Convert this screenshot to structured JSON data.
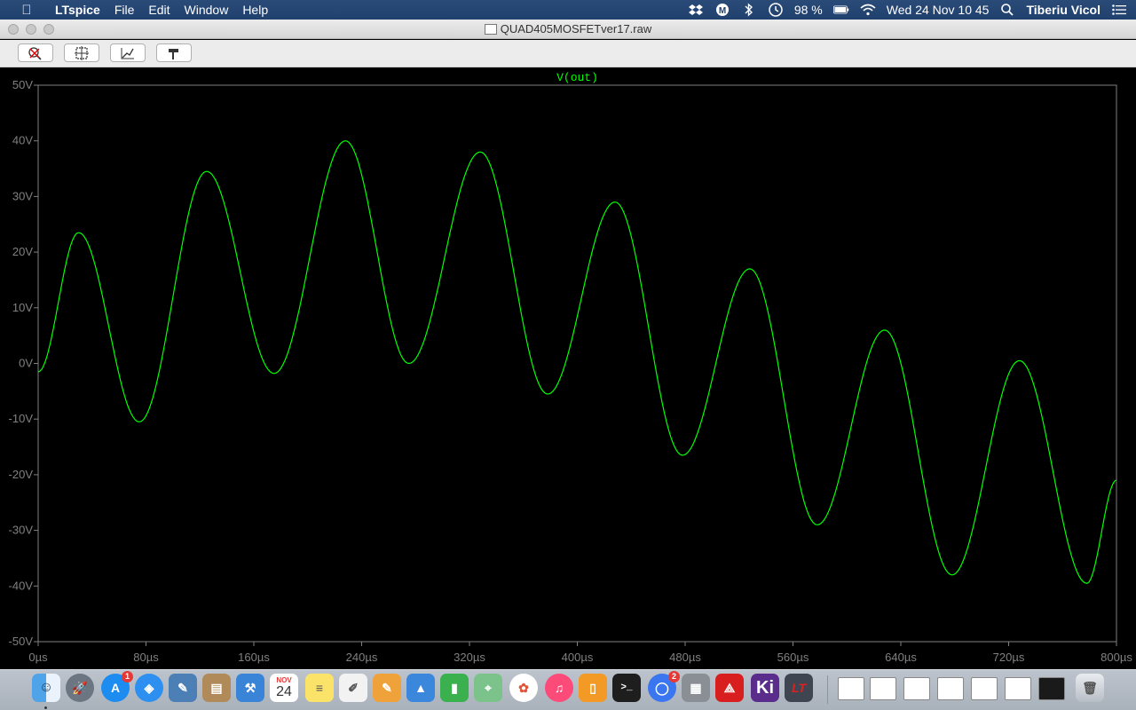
{
  "menubar": {
    "app_name": "LTspice",
    "items": [
      "File",
      "Edit",
      "Window",
      "Help"
    ],
    "battery": "98 %",
    "datetime": "Wed 24 Nov  10 45",
    "user": "Tiberiu Vicol"
  },
  "window": {
    "title": "QUAD405MOSFETver17.raw"
  },
  "toolbar": {
    "buttons": [
      "zoom-off-icon",
      "zoom-extents-icon",
      "zoom-back-icon",
      "hammer-icon"
    ]
  },
  "chart_data": {
    "type": "line",
    "series": [
      {
        "name": "V(out)",
        "color": "#00ff00",
        "x_unit": "µs",
        "y_unit": "V",
        "x": [
          0,
          30,
          75,
          125,
          175,
          228,
          275,
          328,
          378,
          428,
          478,
          528,
          578,
          628,
          678,
          728,
          778,
          800
        ],
        "y": [
          -1.5,
          23.5,
          -10.5,
          34.5,
          -1.8,
          40,
          0,
          38,
          -5.5,
          29,
          -16.5,
          17,
          -29,
          6,
          -38,
          0.5,
          -39.5,
          -21
        ]
      }
    ],
    "xlim": [
      0,
      800
    ],
    "ylim": [
      -50,
      50
    ],
    "xticks": [
      {
        "value": 0,
        "label": "0µs"
      },
      {
        "value": 80,
        "label": "80µs"
      },
      {
        "value": 160,
        "label": "160µs"
      },
      {
        "value": 240,
        "label": "240µs"
      },
      {
        "value": 320,
        "label": "320µs"
      },
      {
        "value": 400,
        "label": "400µs"
      },
      {
        "value": 480,
        "label": "480µs"
      },
      {
        "value": 560,
        "label": "560µs"
      },
      {
        "value": 640,
        "label": "640µs"
      },
      {
        "value": 720,
        "label": "720µs"
      },
      {
        "value": 800,
        "label": "800µs"
      }
    ],
    "yticks": [
      {
        "value": 50,
        "label": "50V"
      },
      {
        "value": 40,
        "label": "40V"
      },
      {
        "value": 30,
        "label": "30V"
      },
      {
        "value": 20,
        "label": "20V"
      },
      {
        "value": 10,
        "label": "10V"
      },
      {
        "value": 0,
        "label": "0V"
      },
      {
        "value": -10,
        "label": "-10V"
      },
      {
        "value": -20,
        "label": "-20V"
      },
      {
        "value": -30,
        "label": "-30V"
      },
      {
        "value": -40,
        "label": "-40V"
      },
      {
        "value": -50,
        "label": "-50V"
      }
    ],
    "grid": false,
    "axis_color": "#808080"
  },
  "dock": {
    "badges": {
      "app_store": "1",
      "signal": "2"
    },
    "calendar": {
      "month": "NOV",
      "day": "24"
    },
    "kicad_label": "Ki",
    "lt_label": "LT"
  }
}
